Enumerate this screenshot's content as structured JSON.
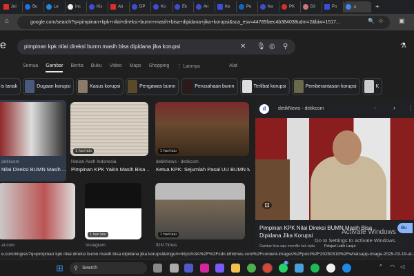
{
  "tabs": [
    "Jul",
    "Bu",
    "Le",
    "Inc",
    "Kis",
    "Ab",
    "DP",
    "Ko",
    "Ek",
    "An",
    "Ke",
    "Pe",
    "Ka",
    "PK",
    "Dii",
    "Po"
  ],
  "address": {
    "url": "google.com/search?q=pimpinan+kpk+nilai+direksi+bumn+masih+bisa+dipidana+jika+korupsi&sca_esv=44785faec4b384038udm=2&biw=1517..."
  },
  "search": {
    "query": "pimpinan kpk nilai direksi bumn masih bisa dipidana jika korupsi"
  },
  "nav": {
    "items": [
      "Semua",
      "Gambar",
      "Berita",
      "Buku",
      "Video",
      "Maps",
      "Shopping",
      "⋮ Lainnya"
    ],
    "tools": "Alat"
  },
  "chips": [
    "is tanak",
    "Dugaan korupsi",
    "Kasus korupsi",
    "Pengawas bumn",
    "Perusahaan bumn",
    "Terlibat korupsi",
    "Pemberantasan korupsi",
    "K"
  ],
  "results": [
    {
      "source": "detikcom",
      "title": "Nilai Direksi BUMN Masih ...",
      "badge": ""
    },
    {
      "source": "Harian Aceh Indonesia",
      "title": "Pimpinan KPK Yakin Masih Bisa ...",
      "badge": "1 hari lalu"
    },
    {
      "source": "detikNews - detikcom",
      "title": "Ketua KPK: Sejumlah Pasal UU BUMN M...",
      "badge": "1 hari lalu"
    },
    {
      "source": "ar.com",
      "title": "Yakin Masih Bisa Usut Korupsi d...",
      "badge": ""
    },
    {
      "source": "Instagram",
      "title": "AKUN RESMI BATURAJA ...",
      "badge": "1 hari lalu"
    },
    {
      "source": "IDN Times",
      "title": "Pimpinan KPK Sebut Direksi BUMN Masih ...",
      "badge": "1 hari lalu"
    }
  ],
  "panel": {
    "source": "detikNews - detikcom",
    "title": "Pimpinan KPK Nilai Direksi BUMN Masih Bisa Dipidana Jika Korupsi",
    "copyright": "Gambar bisa saja memiliki hak cipta.",
    "learn": "Pelajari Lebih Lanjut",
    "visit": "Bu"
  },
  "watermark": {
    "line1": "Activate Windows",
    "line2": "Go to Settings to activate Windows."
  },
  "status": "e.com/imgres?q=pimpinan kpk nilai direksi bumn masih bisa dipidana jika korupsi&imgurl=https%3A%2F%2Fcdn.idntimes.com%2Fcontent-images%2Fpost%2F20250319%2Fwhatsapp-image-2025-03-19-at-143818-a53",
  "taskbar": {
    "search": "Search",
    "whatsapp_badge": "5"
  }
}
